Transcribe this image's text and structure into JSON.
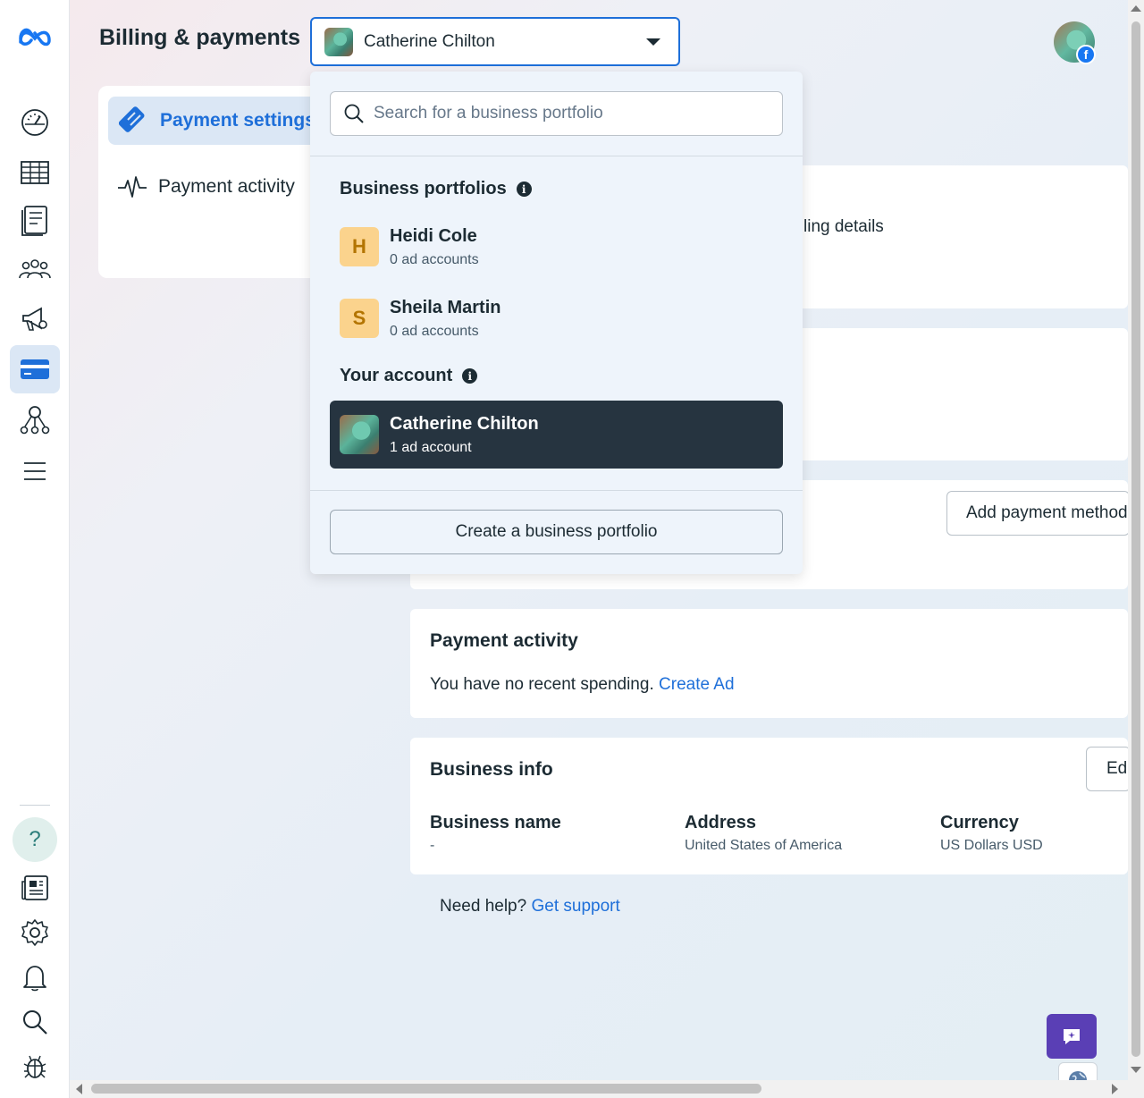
{
  "header": {
    "title": "Billing & payments",
    "account_selector": {
      "selected": "Catherine Chilton"
    }
  },
  "left_nav": {
    "items": [
      {
        "label": "Payment settings",
        "active": true
      },
      {
        "label": "Payment activity",
        "active": false
      }
    ]
  },
  "background": {
    "billing_details_partial": "billing details",
    "add_payment_partial": "Add payment method",
    "payment_activity": {
      "title": "Payment activity",
      "text": "You have no recent spending.",
      "link": "Create Ad"
    },
    "business_info": {
      "title": "Business info",
      "edit_partial": "Edit",
      "fields": [
        {
          "label": "Business name",
          "value": "-"
        },
        {
          "label": "Address",
          "value": "United States of America"
        },
        {
          "label": "Currency",
          "value": "US Dollars USD"
        }
      ]
    },
    "help": {
      "text": "Need help?",
      "link": "Get support"
    }
  },
  "dropdown": {
    "search_placeholder": "Search for a business portfolio",
    "portfolios_heading": "Business portfolios",
    "portfolios": [
      {
        "initial": "H",
        "name": "Heidi Cole",
        "sub": "0 ad accounts"
      },
      {
        "initial": "S",
        "name": "Sheila Martin",
        "sub": "0 ad accounts"
      }
    ],
    "your_account_heading": "Your account",
    "your_account": {
      "name": "Catherine Chilton",
      "sub": "1 ad account"
    },
    "create_button": "Create a business portfolio"
  },
  "colors": {
    "accent": "#1e6fd9",
    "selected_item_bg": "#263440",
    "letter_avatar_bg": "#fbd38d",
    "chat_button": "#5a3fb5"
  },
  "icons": {
    "rail": [
      "meta-logo-icon",
      "dashboard-icon",
      "table-icon",
      "pages-icon",
      "audience-icon",
      "campaign-icon",
      "billing-icon",
      "hierarchy-icon",
      "menu-icon",
      "help-icon",
      "news-icon",
      "settings-icon",
      "bell-icon",
      "search-icon",
      "bug-icon"
    ]
  }
}
